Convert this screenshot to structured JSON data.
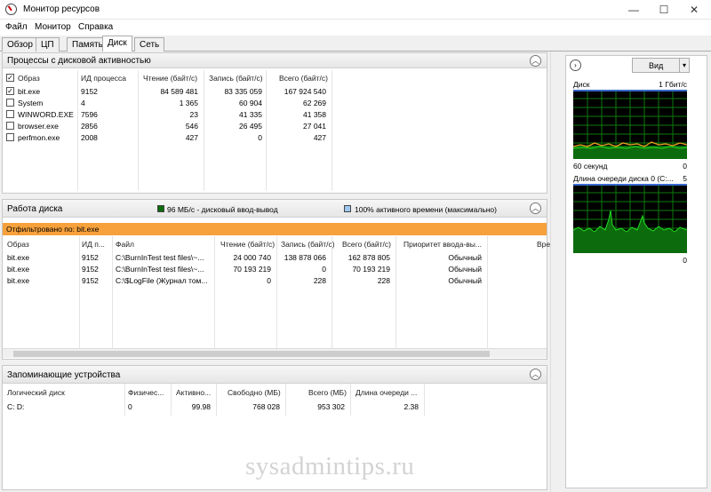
{
  "window": {
    "title": "Монитор ресурсов",
    "minimize": "—",
    "maximize": "☐",
    "close": "✕"
  },
  "menu": [
    "Файл",
    "Монитор",
    "Справка"
  ],
  "tabs": [
    "Обзор",
    "ЦП",
    "Память",
    "Диск",
    "Сеть"
  ],
  "active_tab": "Диск",
  "processes_panel": {
    "title": "Процессы с дисковой активностью",
    "columns": [
      "Образ",
      "ИД процесса",
      "Чтение (байт/с)",
      "Запись (байт/с)",
      "Всего (байт/с)"
    ],
    "rows": [
      {
        "checked": true,
        "image": "bit.exe",
        "pid": "9152",
        "read": "84 589 481",
        "write": "83 335 059",
        "total": "167 924 540"
      },
      {
        "checked": false,
        "image": "System",
        "pid": "4",
        "read": "1 365",
        "write": "60 904",
        "total": "62 269"
      },
      {
        "checked": false,
        "image": "WINWORD.EXE",
        "pid": "7596",
        "read": "23",
        "write": "41 335",
        "total": "41 358"
      },
      {
        "checked": false,
        "image": "browser.exe",
        "pid": "2856",
        "read": "546",
        "write": "26 495",
        "total": "27 041"
      },
      {
        "checked": false,
        "image": "perfmon.exe",
        "pid": "2008",
        "read": "427",
        "write": "0",
        "total": "427"
      }
    ]
  },
  "disk_panel": {
    "title": "Работа диска",
    "legend_io": "96 МБ/с - дисковый ввод-вывод",
    "legend_active": "100% активного времени (максимально)",
    "filter": "Отфильтровано по: bit.exe",
    "columns": [
      "Образ",
      "ИД п...",
      "Файл",
      "Чтение (байт/с)",
      "Запись (байт/с)",
      "Всего (байт/с)",
      "Приоритет ввода-вы...",
      "Вре"
    ],
    "rows": [
      {
        "image": "bit.exe",
        "pid": "9152",
        "file": "C:\\BurnInTest test files\\~...",
        "read": "24 000 740",
        "write": "138 878 066",
        "total": "162 878 805",
        "priority": "Обычный"
      },
      {
        "image": "bit.exe",
        "pid": "9152",
        "file": "C:\\BurnInTest test files\\~...",
        "read": "70 193 219",
        "write": "0",
        "total": "70 193 219",
        "priority": "Обычный"
      },
      {
        "image": "bit.exe",
        "pid": "9152",
        "file": "C:\\$LogFile (Журнал том...",
        "read": "0",
        "write": "228",
        "total": "228",
        "priority": "Обычный"
      }
    ]
  },
  "storage_panel": {
    "title": "Запоминающие устройства",
    "columns": [
      "Логический диск",
      "Физичес...",
      "Активно...",
      "Свободно (МБ)",
      "Всего (МБ)",
      "Длина очереди ..."
    ],
    "rows": [
      {
        "disk": "C: D:",
        "physical": "0",
        "active": "99.98",
        "free": "768 028",
        "total": "953 302",
        "queue": "2.38"
      }
    ]
  },
  "right_panel": {
    "view_button": "Вид",
    "disk_graph": {
      "label": "Диск",
      "scale": "1 Гбит/с",
      "time": "60 секунд",
      "min": "0"
    },
    "queue_graph": {
      "label": "Длина очереди диска 0 (C:...",
      "scale": "5",
      "min": "0"
    }
  },
  "watermark": "sysadmintips.ru",
  "colors": {
    "filter_bar": "#f7a13c",
    "graph_bg": "#000000",
    "graph_grid": "#0e7a0e",
    "graph_line": "#22dd22",
    "graph_orange": "#e8a020",
    "graph_top_line": "#3a6bd0"
  }
}
